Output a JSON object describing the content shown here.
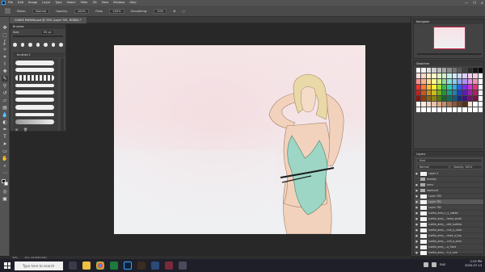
{
  "app": {
    "menu_items": [
      "File",
      "Edit",
      "Image",
      "Layer",
      "Type",
      "Select",
      "Filter",
      "3D",
      "View",
      "Window",
      "Help"
    ],
    "window_controls": [
      "—",
      "❐",
      "✕"
    ]
  },
  "options": {
    "mode_label": "Mode:",
    "mode_value": "Normal",
    "opacity_label": "Opacity:",
    "opacity_value": "100%",
    "flow_label": "Flow:",
    "flow_value": "100%",
    "smoothing_label": "Smoothing:",
    "smoothing_value": "10%"
  },
  "document": {
    "tab_label": "CHARE PAYAMA.psd @ 33% (Layer 781, RGB/8) *",
    "zoom": "33%",
    "doc_info": "Doc: 24.9M/3.44G"
  },
  "brush_panel": {
    "title": "Brushes",
    "size_label": "Size:",
    "size_value": "65 px",
    "folder_label": "brushes 2"
  },
  "right_panels": {
    "navigator_title": "Navigator",
    "swatches_title": "Swatches",
    "layers_title": "Layers",
    "layer_search": "Kind",
    "blend_mode": "Normal",
    "opacity": "Opacity: 100%"
  },
  "layers": [
    {
      "name": "Layer 4",
      "visible": true,
      "selected": false,
      "thumb": true
    },
    {
      "name": "overlay",
      "visible": false,
      "selected": false,
      "thumb": false
    },
    {
      "name": "arms",
      "visible": true,
      "selected": false,
      "thumb": false
    },
    {
      "name": "swimsuit",
      "visible": true,
      "selected": false,
      "thumb": false
    },
    {
      "name": "Layer 783",
      "visible": true,
      "selected": false,
      "thumb": true
    },
    {
      "name": "Layer 781",
      "visible": true,
      "selected": true,
      "thumb": true
    },
    {
      "name": "Layer 782",
      "visible": true,
      "selected": false,
      "thumb": true
    },
    {
      "name": "suelto_areo_c_y_cabbe",
      "visible": true,
      "selected": false,
      "thumb": true
    },
    {
      "name": "suelto_areo_...lama_small",
      "visible": true,
      "selected": false,
      "thumb": true
    },
    {
      "name": "suelto_areo_...dot_sueltos",
      "visible": true,
      "selected": false,
      "thumb": true
    },
    {
      "name": "suelto_areo_...coll_a_cobo",
      "visible": true,
      "selected": false,
      "thumb": true
    },
    {
      "name": "suelto_areo_...read_a_top",
      "visible": true,
      "selected": false,
      "thumb": true
    },
    {
      "name": "suelto_areo_...coll_a_area",
      "visible": true,
      "selected": false,
      "thumb": true
    },
    {
      "name": "suelto_areo_...a_front",
      "visible": true,
      "selected": false,
      "thumb": true
    },
    {
      "name": "suelto_areo_...ll_a_nee",
      "visible": true,
      "selected": false,
      "thumb": true
    }
  ],
  "swatch_colors": [
    "#ffffff",
    "#f2f2f2",
    "#e0e0e0",
    "#cfcfcf",
    "#bbbbbb",
    "#a5a5a5",
    "#8c8c8c",
    "#737373",
    "#5a5a5a",
    "#404040",
    "#2a2a2a",
    "#151515",
    "#000000",
    "#ffe1e1",
    "#ffd4c2",
    "#fff1c4",
    "#fffdc7",
    "#e6f7c2",
    "#cdeed0",
    "#c4efe8",
    "#c8e9f7",
    "#cdd7f7",
    "#dccdf7",
    "#f0cdf2",
    "#f7cde0",
    "#ffffff",
    "#ff8f8f",
    "#ffb08a",
    "#ffd98a",
    "#fff88a",
    "#c9ef85",
    "#8fdb9a",
    "#85e0d0",
    "#8acbef",
    "#8fa5ef",
    "#b08fef",
    "#e08fe4",
    "#ef8fb8",
    "#ffffff",
    "#ff3030",
    "#ff7a30",
    "#ffc030",
    "#fff030",
    "#a0e030",
    "#30c050",
    "#30c8b0",
    "#30a8e8",
    "#3060e0",
    "#7a30e0",
    "#d030d8",
    "#e83080",
    "#ffffff",
    "#c81e1e",
    "#c8581e",
    "#c8941e",
    "#c8c01e",
    "#78b01e",
    "#1e9838",
    "#1e9c88",
    "#1e80b8",
    "#1e44b0",
    "#5a1eb0",
    "#a41ea8",
    "#b41e60",
    "#f0f0f0",
    "#8a1414",
    "#8a3e14",
    "#8a6614",
    "#8a8414",
    "#527814",
    "#14682a",
    "#146c5e",
    "#14587e",
    "#142e78",
    "#3e1478",
    "#701474",
    "#7c1442",
    "#ffffff",
    "#ffffff",
    "#fbe9e2",
    "#f3d6c6",
    "#e9c2a9",
    "#d8a987",
    "#c48e6a",
    "#a87352",
    "#8a5b3f",
    "#6b452f",
    "#4f3322",
    "#f5e6d3",
    "#ffffff",
    "#ffffff",
    "#ffffff",
    "#ffffff",
    "#ffffff",
    "#ffffff",
    "#ffffff",
    "#ffffff",
    "#ffffff",
    "#ffffff",
    "#ffffff",
    "#ffffff",
    "#ffffff",
    "#ffffff",
    "#ffffff"
  ],
  "taskbar": {
    "search_placeholder": "Type here to search",
    "language": "ENG",
    "time": "2:23 PM",
    "date": "2020-07-13"
  }
}
